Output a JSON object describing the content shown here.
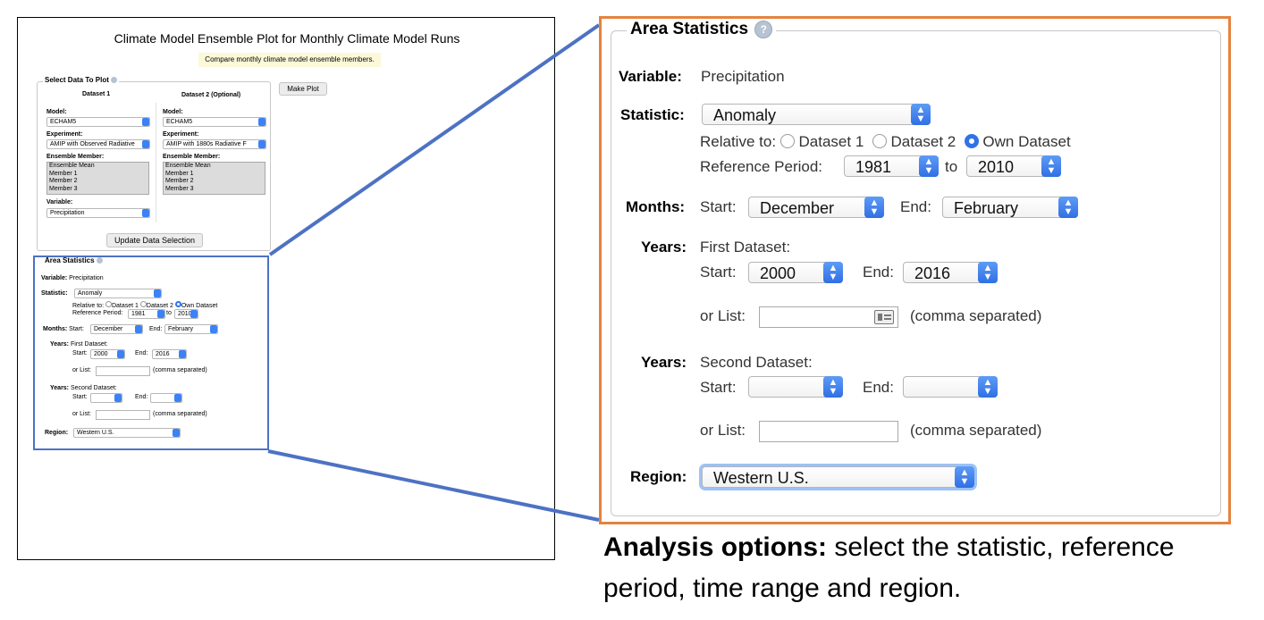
{
  "thumb": {
    "title": "Climate Model Ensemble Plot for Monthly Climate Model Runs",
    "subtitle": "Compare monthly climate model ensemble members.",
    "select_legend": "Select Data To Plot",
    "dataset1_header": "Dataset 1",
    "dataset2_header": "Dataset 2 (Optional)",
    "make_plot": "Make Plot",
    "model_label": "Model:",
    "model1": "ECHAM5",
    "model2": "ECHAM5",
    "experiment_label": "Experiment:",
    "experiment1": "AMIP with Observed Radiative",
    "experiment2": "AMIP with 1880s Radiative F",
    "member_label": "Ensemble Member:",
    "members": [
      "Ensemble Mean",
      "Member 1",
      "Member 2",
      "Member 3"
    ],
    "variable_label": "Variable:",
    "variable": "Precipitation",
    "update_button": "Update Data Selection",
    "area_legend": "Area Statistics",
    "variable_line_label": "Variable:",
    "variable_line_value": "Precipitation",
    "statistic_label": "Statistic:",
    "statistic": "Anomaly",
    "relative_to": "Relative to:",
    "opt_dataset1": "Dataset 1",
    "opt_dataset2": "Dataset 2",
    "opt_own": "Own Dataset",
    "ref_period": "Reference Period:",
    "ref_start": "1981",
    "to": "to",
    "ref_end": "2010",
    "months_label": "Months:",
    "start": "Start:",
    "end": "End:",
    "month_start": "December",
    "month_end": "February",
    "years_label": "Years:",
    "first_dataset": "First Dataset:",
    "year_start": "2000",
    "year_end": "2016",
    "or_list": "or List:",
    "comma": "(comma separated)",
    "second_dataset": "Second Dataset:",
    "region_label": "Region:",
    "region": "Western U.S."
  },
  "zoom": {
    "legend": "Area Statistics",
    "help": "?",
    "variable_label": "Variable:",
    "variable_value": "Precipitation",
    "statistic_label": "Statistic:",
    "statistic": "Anomaly",
    "relative_to": "Relative to:",
    "opt_dataset1": "Dataset 1",
    "opt_dataset2": "Dataset 2",
    "opt_own": "Own Dataset",
    "ref_period": "Reference Period:",
    "ref_start": "1981",
    "to": "to",
    "ref_end": "2010",
    "months_label": "Months:",
    "start": "Start:",
    "end": "End:",
    "month_start": "December",
    "month_end": "February",
    "years_label": "Years:",
    "first_dataset": "First Dataset:",
    "year_start": "2000",
    "year_end": "2016",
    "or_list": "or List:",
    "comma": "(comma separated)",
    "second_dataset": "Second Dataset:",
    "region_label": "Region:",
    "region": "Western U.S."
  },
  "caption": {
    "bold": "Analysis options:",
    "rest": " select the statistic, reference period, time range and region."
  },
  "colors": {
    "highlight_border": "#e4833f",
    "connector": "#4d72c4",
    "select_arrow": "#2f6fe4"
  }
}
